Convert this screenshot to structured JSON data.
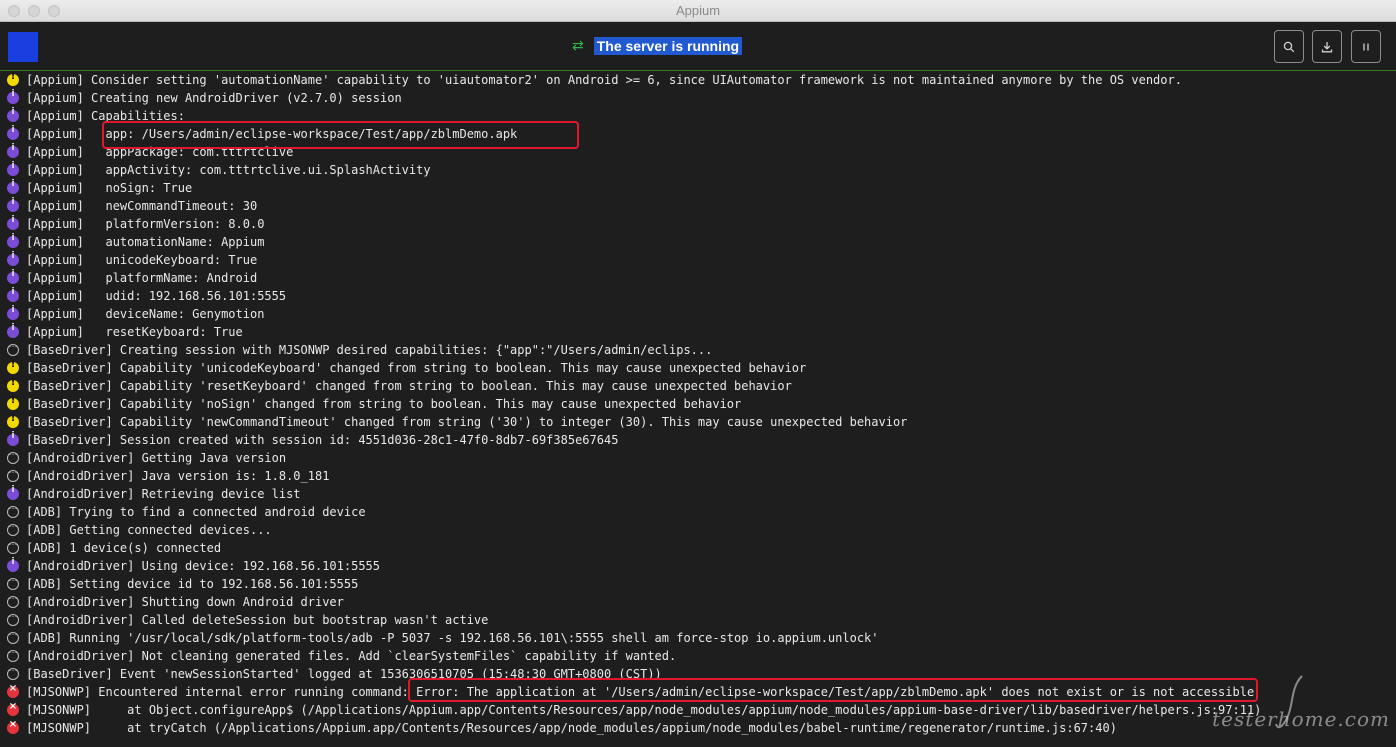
{
  "window": {
    "title": "Appium"
  },
  "header": {
    "status_text": "The server is running"
  },
  "log": [
    {
      "level": "warn",
      "text": "[Appium] Consider setting 'automationName' capability to 'uiautomator2' on Android >= 6, since UIAutomator framework is not maintained anymore by the OS vendor."
    },
    {
      "level": "info",
      "text": "[Appium] Creating new AndroidDriver (v2.7.0) session"
    },
    {
      "level": "info",
      "text": "[Appium] Capabilities:"
    },
    {
      "level": "info",
      "text": "[Appium]   app: /Users/admin/eclipse-workspace/Test/app/zblmDemo.apk"
    },
    {
      "level": "info",
      "text": "[Appium]   appPackage: com.tttrtclive"
    },
    {
      "level": "info",
      "text": "[Appium]   appActivity: com.tttrtclive.ui.SplashActivity"
    },
    {
      "level": "info",
      "text": "[Appium]   noSign: True"
    },
    {
      "level": "info",
      "text": "[Appium]   newCommandTimeout: 30"
    },
    {
      "level": "info",
      "text": "[Appium]   platformVersion: 8.0.0"
    },
    {
      "level": "info",
      "text": "[Appium]   automationName: Appium"
    },
    {
      "level": "info",
      "text": "[Appium]   unicodeKeyboard: True"
    },
    {
      "level": "info",
      "text": "[Appium]   platformName: Android"
    },
    {
      "level": "info",
      "text": "[Appium]   udid: 192.168.56.101:5555"
    },
    {
      "level": "info",
      "text": "[Appium]   deviceName: Genymotion"
    },
    {
      "level": "info",
      "text": "[Appium]   resetKeyboard: True"
    },
    {
      "level": "debug",
      "text": "[BaseDriver] Creating session with MJSONWP desired capabilities: {\"app\":\"/Users/admin/eclips..."
    },
    {
      "level": "warn",
      "text": "[BaseDriver] Capability 'unicodeKeyboard' changed from string to boolean. This may cause unexpected behavior"
    },
    {
      "level": "warn",
      "text": "[BaseDriver] Capability 'resetKeyboard' changed from string to boolean. This may cause unexpected behavior"
    },
    {
      "level": "warn",
      "text": "[BaseDriver] Capability 'noSign' changed from string to boolean. This may cause unexpected behavior"
    },
    {
      "level": "warn",
      "text": "[BaseDriver] Capability 'newCommandTimeout' changed from string ('30') to integer (30). This may cause unexpected behavior"
    },
    {
      "level": "info",
      "text": "[BaseDriver] Session created with session id: 4551d036-28c1-47f0-8db7-69f385e67645"
    },
    {
      "level": "debug",
      "text": "[AndroidDriver] Getting Java version"
    },
    {
      "level": "debug",
      "text": "[AndroidDriver] Java version is: 1.8.0_181"
    },
    {
      "level": "info",
      "text": "[AndroidDriver] Retrieving device list"
    },
    {
      "level": "debug",
      "text": "[ADB] Trying to find a connected android device"
    },
    {
      "level": "debug",
      "text": "[ADB] Getting connected devices..."
    },
    {
      "level": "debug",
      "text": "[ADB] 1 device(s) connected"
    },
    {
      "level": "info",
      "text": "[AndroidDriver] Using device: 192.168.56.101:5555"
    },
    {
      "level": "debug",
      "text": "[ADB] Setting device id to 192.168.56.101:5555"
    },
    {
      "level": "debug",
      "text": "[AndroidDriver] Shutting down Android driver"
    },
    {
      "level": "debug",
      "text": "[AndroidDriver] Called deleteSession but bootstrap wasn't active"
    },
    {
      "level": "debug",
      "text": "[ADB] Running '/usr/local/sdk/platform-tools/adb -P 5037 -s 192.168.56.101\\:5555 shell am force-stop io.appium.unlock'"
    },
    {
      "level": "debug",
      "text": "[AndroidDriver] Not cleaning generated files. Add `clearSystemFiles` capability if wanted."
    },
    {
      "level": "debug",
      "text": "[BaseDriver] Event 'newSessionStarted' logged at 1536306510705 (15:48:30 GMT+0800 (CST))"
    },
    {
      "level": "err",
      "text": "[MJSONWP] Encountered internal error running command: Error: The application at '/Users/admin/eclipse-workspace/Test/app/zblmDemo.apk' does not exist or is not accessible"
    },
    {
      "level": "err",
      "text": "[MJSONWP]     at Object.configureApp$ (/Applications/Appium.app/Contents/Resources/app/node_modules/appium/node_modules/appium-base-driver/lib/basedriver/helpers.js:97:11)"
    },
    {
      "level": "err",
      "text": "[MJSONWP]     at tryCatch (/Applications/Appium.app/Contents/Resources/app/node_modules/appium/node_modules/babel-runtime/regenerator/runtime.js:67:40)"
    }
  ],
  "watermark": "testerhome.com",
  "colors": {
    "logo": "#1a3fe0",
    "running": "#35b34a",
    "warn": "#f2d900",
    "info": "#7b4cd6",
    "error": "#e5343d",
    "highlight": "#e0182d"
  },
  "icons": {
    "status": "refresh-icon",
    "search": "search-icon",
    "download": "download-icon",
    "pause": "pause-icon"
  }
}
